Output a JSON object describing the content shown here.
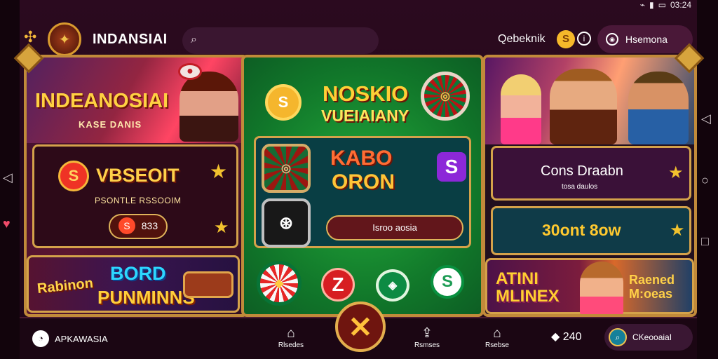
{
  "statusbar": {
    "time": "03:24"
  },
  "header": {
    "brand": "INDANSIAI",
    "username": "Qebeknik",
    "menu_button": "Hsemona",
    "search_placeholder": ""
  },
  "left_panel": {
    "banner_title": "INDEANOSIAI",
    "banner_subtitle": "KASE DANIS",
    "card_title": "VBSEOIT",
    "card_subtitle": "PSONTLE RSSOOIM",
    "card_button": "S",
    "card_button_value": "833",
    "promo_prefix": "Rabinon",
    "promo_title": "BORD",
    "promo_subtitle": "PUNMINNS"
  },
  "center_panel": {
    "title": "NOSKIO",
    "subtitle": "VUEIAIANY",
    "card_title": "KABO",
    "card_subtitle": "ORON",
    "play_button": "Isroo aosia",
    "coin_symbol": "S",
    "purple_symbol": "S",
    "red_chip_label": "Z"
  },
  "right_panel": {
    "card1_title": "Cons Draabn",
    "card1_subtitle": "tosa daulos",
    "card2_title": "30ont 8ow",
    "promo_title": "ATINI MLINEX",
    "promo_side": "Raened M:oeas"
  },
  "bottom_nav": {
    "account_label": "APKAWASIA",
    "items": [
      "Rlsedes",
      "Rsmses",
      "Rsebse"
    ],
    "count": "240",
    "right_button": "CKeooaiaI"
  },
  "close_button": "✕",
  "colors": {
    "accent": "#d4a24a",
    "green": "#168b35",
    "purple": "#4f1c4a"
  }
}
